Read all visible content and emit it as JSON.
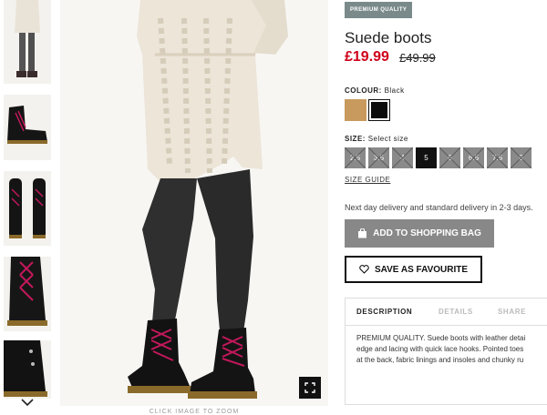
{
  "product": {
    "badge": "PREMIUM QUALITY",
    "title": "Suede boots",
    "price": "£19.99",
    "old_price": "£49.99"
  },
  "colour": {
    "label": "COLOUR:",
    "selected": "Black",
    "swatches": [
      {
        "name": "tan",
        "color": "#c89a5e"
      },
      {
        "name": "black",
        "color": "#0b0b0b"
      }
    ]
  },
  "size": {
    "label": "SIZE:",
    "placeholder": "Select size",
    "options": [
      {
        "label": "2.5",
        "available": false
      },
      {
        "label": "3.5",
        "available": false
      },
      {
        "label": "4",
        "available": false
      },
      {
        "label": "5",
        "available": true
      },
      {
        "label": "6",
        "available": false
      },
      {
        "label": "6.5",
        "available": false
      },
      {
        "label": "7.5",
        "available": false
      },
      {
        "label": "8",
        "available": false
      }
    ],
    "guide": "SIZE GUIDE"
  },
  "delivery_text": "Next day delivery and standard delivery in 2-3 days.",
  "buttons": {
    "add_to_bag": "ADD TO SHOPPING BAG",
    "favourite": "SAVE AS FAVOURITE"
  },
  "tabs": {
    "description": "DESCRIPTION",
    "details": "DETAILS",
    "share": "SHARE"
  },
  "description_lines": [
    "PREMIUM QUALITY. Suede boots with leather detai",
    "edge and lacing with quick lace hooks. Pointed toes",
    "at the back, fabric linings and insoles and chunky ru"
  ],
  "main_image": {
    "caption": "CLICK IMAGE TO ZOOM"
  },
  "icons": {
    "zoom": "expand-icon",
    "bag": "shopping-bag-icon",
    "favourite": "heart-icon",
    "thumbs_next": "chevron-down-icon"
  },
  "colors": {
    "sale_price": "#d0021b",
    "badge_bg": "#7a8a8a",
    "primary_button": "#888888"
  }
}
